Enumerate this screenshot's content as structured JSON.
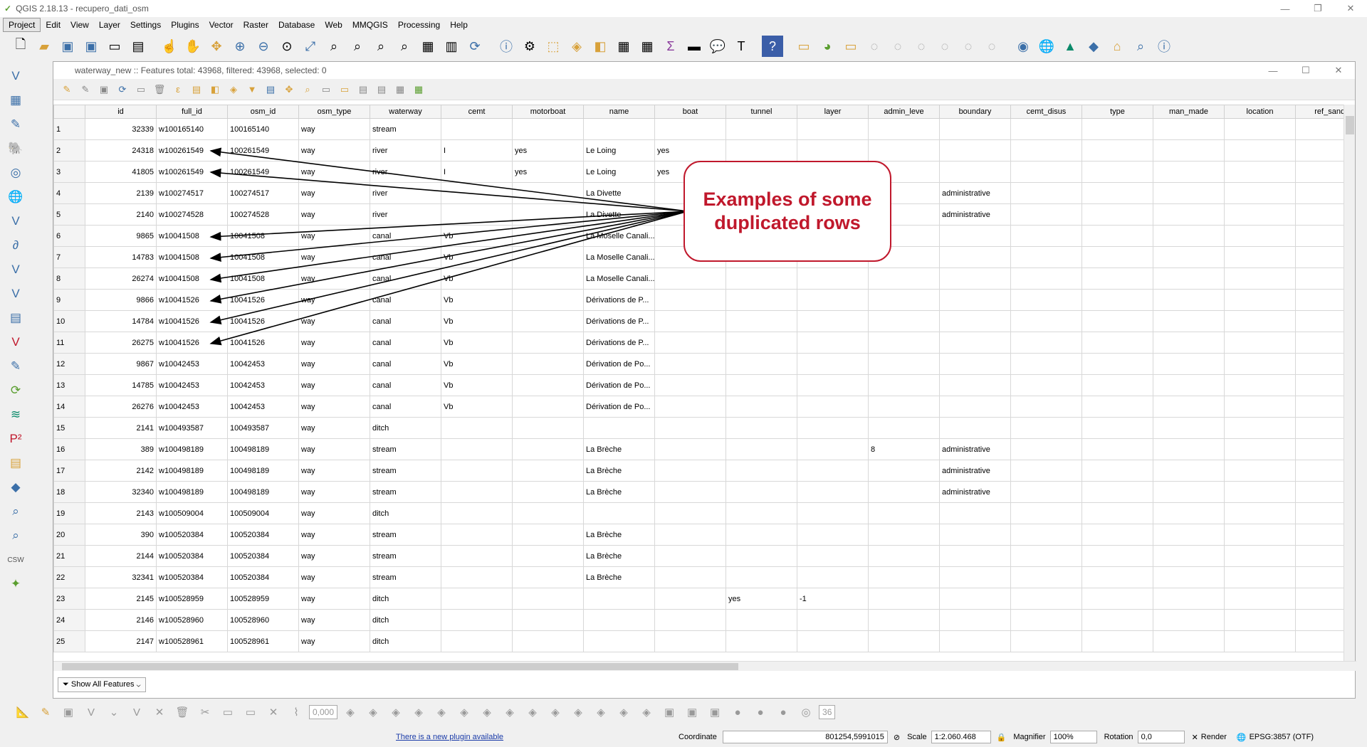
{
  "app": {
    "title": "QGIS 2.18.13 - recupero_dati_osm"
  },
  "menu": [
    "Project",
    "Edit",
    "View",
    "Layer",
    "Settings",
    "Plugins",
    "Vector",
    "Raster",
    "Database",
    "Web",
    "MMQGIS",
    "Processing",
    "Help"
  ],
  "dialog": {
    "title": "waterway_new :: Features total: 43968, filtered: 43968, selected: 0"
  },
  "table": {
    "columns": [
      "id",
      "full_id",
      "osm_id",
      "osm_type",
      "waterway",
      "cemt",
      "motorboat",
      "name",
      "boat",
      "tunnel",
      "layer",
      "admin_leve",
      "boundary",
      "cemt_disus",
      "type",
      "man_made",
      "location",
      "ref_sandr"
    ],
    "rows": [
      [
        "1",
        "32339",
        "w100165140",
        "100165140",
        "way",
        "stream",
        "",
        "",
        "",
        "",
        "",
        "",
        "",
        "",
        "",
        "",
        "",
        "",
        ""
      ],
      [
        "2",
        "24318",
        "w100261549",
        "100261549",
        "way",
        "river",
        "I",
        "yes",
        "Le Loing",
        "yes",
        "",
        "",
        "",
        "",
        "",
        "",
        "",
        "",
        ""
      ],
      [
        "3",
        "41805",
        "w100261549",
        "100261549",
        "way",
        "river",
        "I",
        "yes",
        "Le Loing",
        "yes",
        "",
        "",
        "",
        "",
        "",
        "",
        "",
        "",
        ""
      ],
      [
        "4",
        "2139",
        "w100274517",
        "100274517",
        "way",
        "river",
        "",
        "",
        "La Divette",
        "",
        "",
        "",
        "",
        "administrative",
        "",
        "",
        "",
        "",
        ""
      ],
      [
        "5",
        "2140",
        "w100274528",
        "100274528",
        "way",
        "river",
        "",
        "",
        "La Divette",
        "",
        "",
        "",
        "",
        "administrative",
        "",
        "",
        "",
        "",
        ""
      ],
      [
        "6",
        "9865",
        "w10041508",
        "10041508",
        "way",
        "canal",
        "Vb",
        "",
        "La Moselle Canali...",
        "",
        "",
        "",
        "",
        "",
        "",
        "",
        "",
        "",
        ""
      ],
      [
        "7",
        "14783",
        "w10041508",
        "10041508",
        "way",
        "canal",
        "Vb",
        "",
        "La Moselle Canali...",
        "",
        "",
        "",
        "",
        "",
        "",
        "",
        "",
        "",
        ""
      ],
      [
        "8",
        "26274",
        "w10041508",
        "10041508",
        "way",
        "canal",
        "Vb",
        "",
        "La Moselle Canali...",
        "",
        "",
        "",
        "",
        "",
        "",
        "",
        "",
        "",
        ""
      ],
      [
        "9",
        "9866",
        "w10041526",
        "10041526",
        "way",
        "canal",
        "Vb",
        "",
        "Dérivations de P...",
        "",
        "",
        "",
        "",
        "",
        "",
        "",
        "",
        "",
        ""
      ],
      [
        "10",
        "14784",
        "w10041526",
        "10041526",
        "way",
        "canal",
        "Vb",
        "",
        "Dérivations de P...",
        "",
        "",
        "",
        "",
        "",
        "",
        "",
        "",
        "",
        ""
      ],
      [
        "11",
        "26275",
        "w10041526",
        "10041526",
        "way",
        "canal",
        "Vb",
        "",
        "Dérivations de P...",
        "",
        "",
        "",
        "",
        "",
        "",
        "",
        "",
        "",
        ""
      ],
      [
        "12",
        "9867",
        "w10042453",
        "10042453",
        "way",
        "canal",
        "Vb",
        "",
        "Dérivation de Po...",
        "",
        "",
        "",
        "",
        "",
        "",
        "",
        "",
        "",
        ""
      ],
      [
        "13",
        "14785",
        "w10042453",
        "10042453",
        "way",
        "canal",
        "Vb",
        "",
        "Dérivation de Po...",
        "",
        "",
        "",
        "",
        "",
        "",
        "",
        "",
        "",
        ""
      ],
      [
        "14",
        "26276",
        "w10042453",
        "10042453",
        "way",
        "canal",
        "Vb",
        "",
        "Dérivation de Po...",
        "",
        "",
        "",
        "",
        "",
        "",
        "",
        "",
        "",
        ""
      ],
      [
        "15",
        "2141",
        "w100493587",
        "100493587",
        "way",
        "ditch",
        "",
        "",
        "",
        "",
        "",
        "",
        "",
        "",
        "",
        "",
        "",
        "",
        ""
      ],
      [
        "16",
        "389",
        "w100498189",
        "100498189",
        "way",
        "stream",
        "",
        "",
        "La Brèche",
        "",
        "",
        "",
        "8",
        "administrative",
        "",
        "",
        "",
        "",
        ""
      ],
      [
        "17",
        "2142",
        "w100498189",
        "100498189",
        "way",
        "stream",
        "",
        "",
        "La Brèche",
        "",
        "",
        "",
        "",
        "administrative",
        "",
        "",
        "",
        "",
        ""
      ],
      [
        "18",
        "32340",
        "w100498189",
        "100498189",
        "way",
        "stream",
        "",
        "",
        "La Brèche",
        "",
        "",
        "",
        "",
        "administrative",
        "",
        "",
        "",
        "",
        ""
      ],
      [
        "19",
        "2143",
        "w100509004",
        "100509004",
        "way",
        "ditch",
        "",
        "",
        "",
        "",
        "",
        "",
        "",
        "",
        "",
        "",
        "",
        "",
        ""
      ],
      [
        "20",
        "390",
        "w100520384",
        "100520384",
        "way",
        "stream",
        "",
        "",
        "La Brèche",
        "",
        "",
        "",
        "",
        "",
        "",
        "",
        "",
        "",
        ""
      ],
      [
        "21",
        "2144",
        "w100520384",
        "100520384",
        "way",
        "stream",
        "",
        "",
        "La Brèche",
        "",
        "",
        "",
        "",
        "",
        "",
        "",
        "",
        "",
        ""
      ],
      [
        "22",
        "32341",
        "w100520384",
        "100520384",
        "way",
        "stream",
        "",
        "",
        "La Brèche",
        "",
        "",
        "",
        "",
        "",
        "",
        "",
        "",
        "",
        ""
      ],
      [
        "23",
        "2145",
        "w100528959",
        "100528959",
        "way",
        "ditch",
        "",
        "",
        "",
        "",
        "yes",
        "-1",
        "",
        "",
        "",
        "",
        "",
        "",
        ""
      ],
      [
        "24",
        "2146",
        "w100528960",
        "100528960",
        "way",
        "ditch",
        "",
        "",
        "",
        "",
        "",
        "",
        "",
        "",
        "",
        "",
        "",
        "",
        ""
      ],
      [
        "25",
        "2147",
        "w100528961",
        "100528961",
        "way",
        "ditch",
        "",
        "",
        "",
        "",
        "",
        "",
        "",
        "",
        "",
        "",
        "",
        "",
        ""
      ]
    ]
  },
  "footer": {
    "filter_label": "Show All Features"
  },
  "callout": {
    "line1": "Examples of some",
    "line2": "duplicated rows"
  },
  "toolbar2": {
    "digit_value": "0,000",
    "snap_value": "36"
  },
  "status": {
    "plugin_link": "There is a new plugin available",
    "coordinate_label": "Coordinate",
    "coordinate_value": "801254,5991015",
    "scale_label": "Scale",
    "scale_value": "1:2.060.468",
    "magnifier_label": "Magnifier",
    "magnifier_value": "100%",
    "rotation_label": "Rotation",
    "rotation_value": "0,0",
    "render_label": "Render",
    "crs": "EPSG:3857 (OTF)"
  },
  "colors": {
    "callout": "#c0182c",
    "link": "#1a3ba8"
  }
}
